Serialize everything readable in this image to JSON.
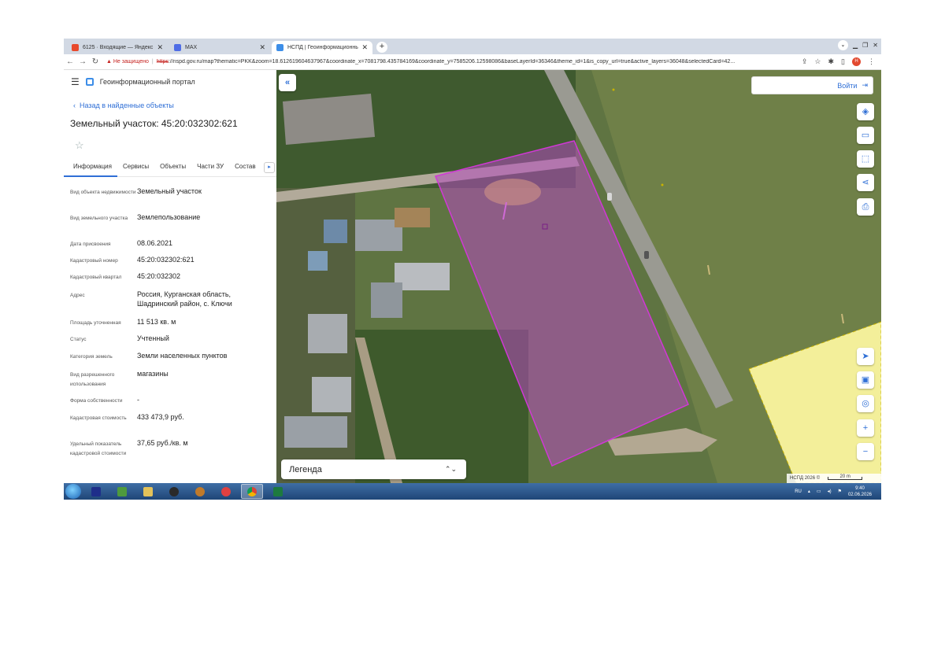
{
  "browser": {
    "tabs": [
      {
        "title": "6125 · Входящие — Яндекс Поч",
        "favicon_color": "#e8492c"
      },
      {
        "title": "MAX",
        "favicon_color": "#4f6de6"
      },
      {
        "title": "НСПД | Геоинформационный п",
        "favicon_color": "#3d8ee8"
      }
    ],
    "close_glyph": "✕",
    "new_tab_glyph": "+",
    "security_warning": "▲ Не защищено",
    "url_scheme": "https",
    "url_rest": "://nspd.gov.ru/map?thematic=PKK&zoom=18.612619604637967&coordinate_x=7081798.435784169&coordinate_y=7585206.12598086&baseLayerId=36346&theme_id=1&is_copy_url=true&active_layers=36048&selectedCard=42...",
    "profile_initial": "Н"
  },
  "app": {
    "title": "Геоинформационный портал",
    "back_link": "Назад в найденные объекты",
    "object_title": "Земельный участок: 45:20:032302:621"
  },
  "panel_tabs": [
    "Информация",
    "Сервисы",
    "Объекты",
    "Части ЗУ",
    "Состав"
  ],
  "info_rows": [
    {
      "label": "Вид объекта недвижимости",
      "value": "Земельный участок"
    },
    {
      "label": "Вид земельного участка",
      "value": "Землепользование"
    },
    {
      "label": "Дата присвоения",
      "value": "08.06.2021"
    },
    {
      "label": "Кадастровый номер",
      "value": "45:20:032302:621"
    },
    {
      "label": "Кадастровый квартал",
      "value": "45:20:032302"
    },
    {
      "label": "Адрес",
      "value": "Россия, Курганская область, Шадринский район, с. Ключи"
    },
    {
      "label": "Площадь уточненная",
      "value": "11 513 кв. м"
    },
    {
      "label": "Статус",
      "value": "Учтенный"
    },
    {
      "label": "Категория земель",
      "value": "Земли населенных пунктов"
    },
    {
      "label": "Вид разрешенного использования",
      "value": "магазины"
    },
    {
      "label": "Форма собственности",
      "value": "-"
    },
    {
      "label": "Кадастровая стоимость",
      "value": "433 473,9 руб."
    },
    {
      "label": "Удельный показатель кадастровой стоимости",
      "value": "37,65 руб./кв. м"
    }
  ],
  "map": {
    "login_label": "Войти",
    "legend_label": "Легенда",
    "attribution": "НСПД 2026 ©",
    "scale_label": "20 m",
    "parcel_color": "#b44bbf",
    "zone_color": "#f3ef9a",
    "controls_top": [
      "layers-icon",
      "ruler-icon",
      "select-area-icon",
      "share-icon",
      "print-icon"
    ],
    "controls_bottom": [
      "locate-icon",
      "minimap-icon",
      "geolocation-icon",
      "zoom-in-icon",
      "zoom-out-icon"
    ]
  },
  "taskbar": {
    "lang": "RU",
    "time": "9:40",
    "date": "02.06.2026"
  }
}
